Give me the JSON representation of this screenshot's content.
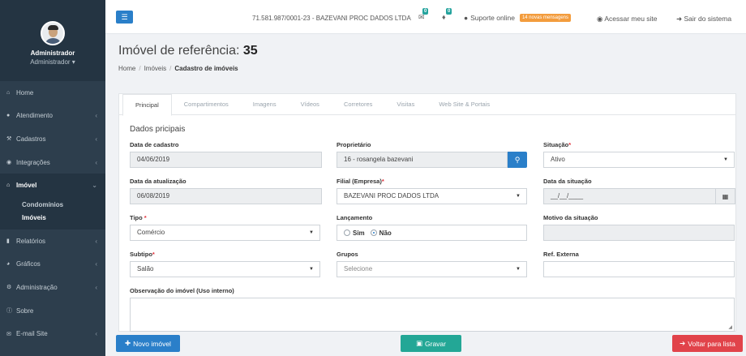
{
  "user": {
    "name": "Administrador",
    "role": "Administrador ▾"
  },
  "sidebar": {
    "items": [
      {
        "label": "Home",
        "icon": "home-icon"
      },
      {
        "label": "Atendimento",
        "icon": "comments-icon"
      },
      {
        "label": "Cadastros",
        "icon": "wrench-icon"
      },
      {
        "label": "Integrações",
        "icon": "globe-icon"
      },
      {
        "label": "Imóvel",
        "icon": "home-icon"
      },
      {
        "label": "Relatórios",
        "icon": "book-icon"
      },
      {
        "label": "Gráficos",
        "icon": "pie-chart-icon"
      },
      {
        "label": "Administração",
        "icon": "cog-icon"
      },
      {
        "label": "Sobre",
        "icon": "info-icon"
      },
      {
        "label": "E-mail Site",
        "icon": "envelope-icon"
      }
    ],
    "submenu": [
      "Condomínios",
      "Imóveis"
    ]
  },
  "topbar": {
    "company": "71.581.987/0001-23 - BAZEVANI PROC DADOS LTDA",
    "mail_count": "0",
    "bell_count": "0",
    "support": "Suporte online",
    "messages": "14 novas mensagens",
    "site": "Acessar meu site",
    "logout": "Sair do sistema"
  },
  "page": {
    "title": "Imóvel de referência:",
    "ref": "35",
    "breadcrumb": [
      "Home",
      "Imóveis",
      "Cadastro de imóveis"
    ]
  },
  "tabs": [
    "Principal",
    "Compartimentos",
    "Imagens",
    "Vídeos",
    "Corretores",
    "Visitas",
    "Web Site & Portais"
  ],
  "form": {
    "section": "Dados pricipais",
    "data_cadastro": {
      "label": "Data de cadastro",
      "value": "04/06/2019"
    },
    "proprietario": {
      "label": "Proprietário",
      "value": "16 - rosangela bazevani"
    },
    "situacao": {
      "label": "Situação",
      "value": "Ativo"
    },
    "data_atualizacao": {
      "label": "Data da atualização",
      "value": "06/08/2019"
    },
    "filial": {
      "label": "Filial (Empresa)",
      "value": "BAZEVANI PROC DADOS LTDA"
    },
    "data_situacao": {
      "label": "Data da situação",
      "value": "__/__/____"
    },
    "tipo": {
      "label": "Tipo",
      "value": "Comércio"
    },
    "lancamento": {
      "label": "Lançamento",
      "opt_sim": "Sim",
      "opt_nao": "Não",
      "selected": "Não"
    },
    "motivo": {
      "label": "Motivo da situação",
      "value": ""
    },
    "subtipo": {
      "label": "Subtipo",
      "value": "Salão"
    },
    "grupos": {
      "label": "Grupos",
      "placeholder": "Selecione"
    },
    "ref_externa": {
      "label": "Ref. Externa",
      "value": ""
    },
    "observacao": {
      "label": "Observação do imóvel (Uso interno)",
      "value": ""
    },
    "required_mark": "*"
  },
  "buttons": {
    "new": "Novo imóvel",
    "save": "Gravar",
    "back": "Voltar para lista"
  }
}
